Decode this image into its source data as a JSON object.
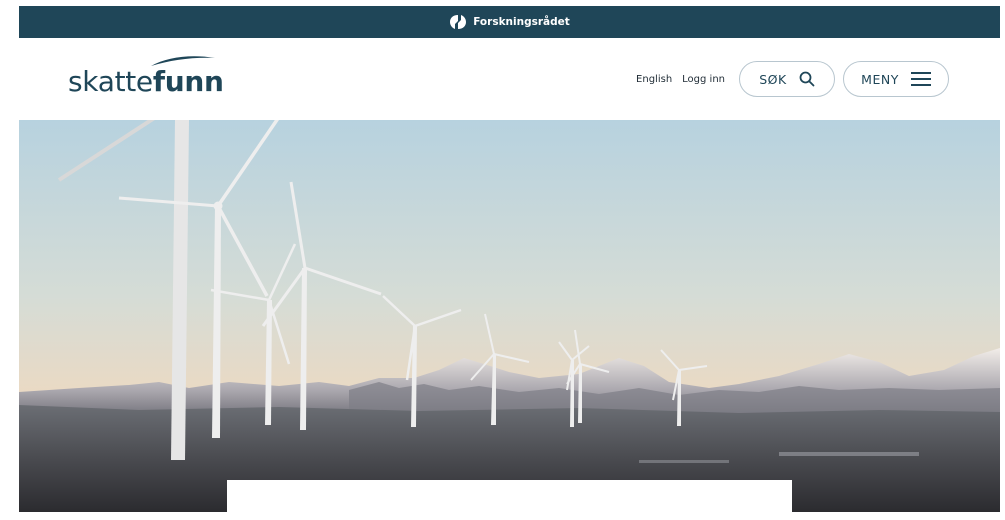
{
  "topbar": {
    "org_name": "Forskningsrådet",
    "logo_icon": "forskningsradet-logo-icon"
  },
  "header": {
    "logo": {
      "part1": "skatte",
      "part2": "funn"
    },
    "nav": {
      "english_label": "English",
      "login_label": "Logg inn",
      "search_label": "SØK",
      "search_icon": "search-icon",
      "menu_label": "MENY",
      "menu_icon": "hamburger-icon"
    }
  },
  "hero": {
    "image": "wind-turbines-mountains-dusk-photo"
  },
  "colors": {
    "brand_dark": "#1f4658",
    "border": "#b8c6cf",
    "sky_top": "#b9d3e0",
    "sky_horizon": "#e9d9c4"
  }
}
